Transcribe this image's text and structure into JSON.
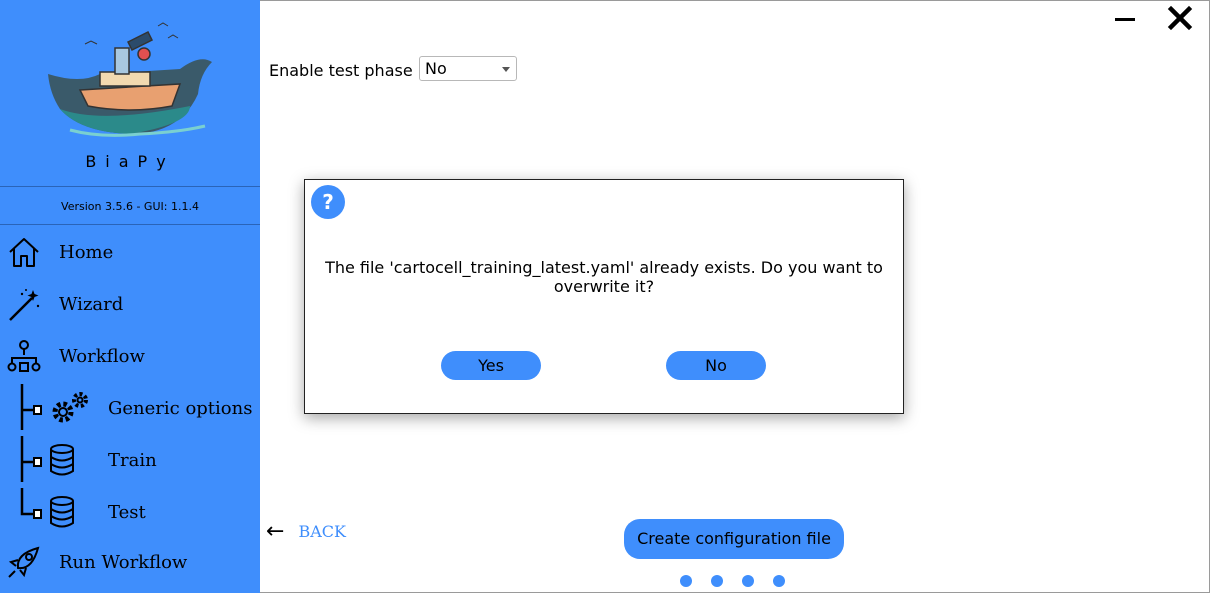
{
  "sidebar": {
    "app_name": "BiaPy",
    "version": "Version 3.5.6 - GUI: 1.1.4",
    "items": [
      {
        "label": "Home",
        "icon": "home-icon"
      },
      {
        "label": "Wizard",
        "icon": "magic-wand-icon"
      },
      {
        "label": "Workflow",
        "icon": "workflow-icon"
      },
      {
        "label": "Generic options",
        "icon": "gears-icon"
      },
      {
        "label": "Train",
        "icon": "database-icon"
      },
      {
        "label": "Test",
        "icon": "database-icon"
      },
      {
        "label": "Run Workflow",
        "icon": "rocket-icon"
      }
    ]
  },
  "window": {
    "minimize_icon": "minimize-icon",
    "close_icon": "close-icon"
  },
  "form": {
    "enable_test_phase_label": "Enable test phase",
    "enable_test_phase_value": "No"
  },
  "nav": {
    "back_arrow": "←",
    "back_label": "BACK",
    "create_label": "Create configuration file",
    "page_count": 4
  },
  "dialog": {
    "icon": "question-icon",
    "icon_glyph": "?",
    "message_line1": "The file 'cartocell_training_latest.yaml' already exists. Do you want to",
    "message_line2": "overwrite it?",
    "yes_label": "Yes",
    "no_label": "No"
  },
  "colors": {
    "accent": "#3f8efc",
    "link": "#3f8efc"
  }
}
